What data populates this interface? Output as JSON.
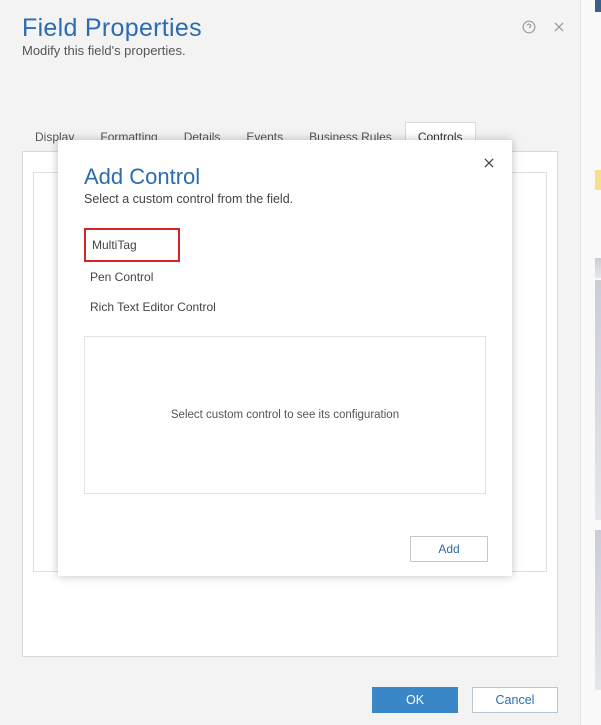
{
  "header": {
    "title": "Field Properties",
    "subtitle": "Modify this field's properties."
  },
  "tabs": {
    "items": [
      {
        "label": "Display"
      },
      {
        "label": "Formatting"
      },
      {
        "label": "Details"
      },
      {
        "label": "Events"
      },
      {
        "label": "Business Rules"
      },
      {
        "label": "Controls"
      }
    ],
    "active": 5
  },
  "modal": {
    "title": "Add Control",
    "subtitle": "Select a custom control from the field.",
    "controls": [
      {
        "label": "MultiTag"
      },
      {
        "label": "Pen Control"
      },
      {
        "label": "Rich Text Editor Control"
      }
    ],
    "config_placeholder": "Select custom control to see its configuration",
    "add_label": "Add"
  },
  "footer": {
    "ok_label": "OK",
    "cancel_label": "Cancel"
  }
}
